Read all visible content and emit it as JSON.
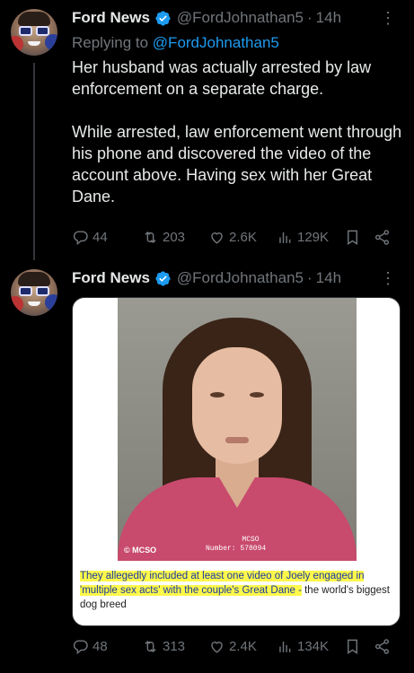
{
  "tweets": [
    {
      "author_name": "Ford News",
      "handle": "@FordJohnathan5",
      "separator": "·",
      "time": "14h",
      "reply_label": "Replying to",
      "reply_mention": "@FordJohnathan5",
      "paragraphs": [
        "Her husband was actually arrested by law enforcement on a separate charge.",
        "While arrested, law enforcement went through his phone and discovered the video of the account above. Having sex with her Great Dane."
      ],
      "replies": "44",
      "reposts": "203",
      "likes": "2.6K",
      "views": "129K"
    },
    {
      "author_name": "Ford News",
      "handle": "@FordJohnathan5",
      "separator": "·",
      "time": "14h",
      "media": {
        "watermark": "© MCSO",
        "plate_agency": "MCSO",
        "plate_number": "Number: 578094",
        "caption_highlight": "They allegedly included at least one video of Joely engaged in 'multiple sex acts' with the couple's Great Dane -",
        "caption_rest": " the world's biggest dog breed"
      },
      "replies": "48",
      "reposts": "313",
      "likes": "2.4K",
      "views": "134K"
    }
  ],
  "more_glyph": "⋮",
  "colors": {
    "accent": "#1d9bf0",
    "muted": "#71767b",
    "text": "#e7e9ea",
    "background": "#000000",
    "highlight": "#fdf84a"
  },
  "icons": [
    "reply-icon",
    "repost-icon",
    "like-icon",
    "views-icon",
    "bookmark-icon",
    "share-icon",
    "verified-badge-icon",
    "more-icon"
  ]
}
